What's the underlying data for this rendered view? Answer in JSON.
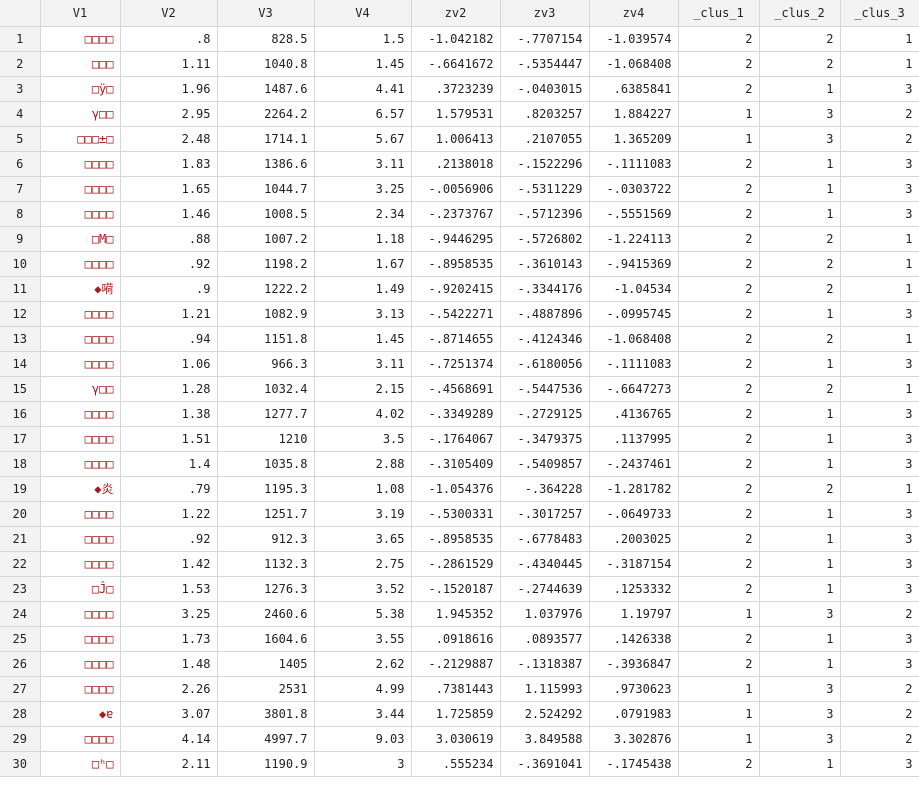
{
  "columns": [
    "",
    "V1",
    "V2",
    "V3",
    "V4",
    "zv2",
    "zv3",
    "zv4",
    "_clus_1",
    "_clus_2",
    "_clus_3"
  ],
  "rows": [
    [
      "1",
      "□□□□",
      ".8",
      "828.5",
      "1.5",
      "-1.042182",
      "-.7707154",
      "-1.039574",
      "2",
      "2",
      "1"
    ],
    [
      "2",
      "□□□",
      "1.11",
      "1040.8",
      "1.45",
      "-.6641672",
      "-.5354447",
      "-1.068408",
      "2",
      "2",
      "1"
    ],
    [
      "3",
      "□ÿ□",
      "1.96",
      "1487.6",
      "4.41",
      ".3723239",
      "-.0403015",
      ".6385841",
      "2",
      "1",
      "3"
    ],
    [
      "4",
      "γ□□",
      "2.95",
      "2264.2",
      "6.57",
      "1.579531",
      ".8203257",
      "1.884227",
      "1",
      "3",
      "2"
    ],
    [
      "5",
      "□□□±□",
      "2.48",
      "1714.1",
      "5.67",
      "1.006413",
      ".2107055",
      "1.365209",
      "1",
      "3",
      "2"
    ],
    [
      "6",
      "□□□□",
      "1.83",
      "1386.6",
      "3.11",
      ".2138018",
      "-.1522296",
      "-.1111083",
      "2",
      "1",
      "3"
    ],
    [
      "7",
      "□□□□",
      "1.65",
      "1044.7",
      "3.25",
      "-.0056906",
      "-.5311229",
      "-.0303722",
      "2",
      "1",
      "3"
    ],
    [
      "8",
      "□□□□",
      "1.46",
      "1008.5",
      "2.34",
      "-.2373767",
      "-.5712396",
      "-.5551569",
      "2",
      "1",
      "3"
    ],
    [
      "9",
      "□M□",
      ".88",
      "1007.2",
      "1.18",
      "-.9446295",
      "-.5726802",
      "-1.224113",
      "2",
      "2",
      "1"
    ],
    [
      "10",
      "□□□□",
      ".92",
      "1198.2",
      "1.67",
      "-.8958535",
      "-.3610143",
      "-.9415369",
      "2",
      "2",
      "1"
    ],
    [
      "11",
      "◆嗬",
      ".9",
      "1222.2",
      "1.49",
      "-.9202415",
      "-.3344176",
      "-1.04534",
      "2",
      "2",
      "1"
    ],
    [
      "12",
      "□□□□",
      "1.21",
      "1082.9",
      "3.13",
      "-.5422271",
      "-.4887896",
      "-.0995745",
      "2",
      "1",
      "3"
    ],
    [
      "13",
      "□□□□",
      ".94",
      "1151.8",
      "1.45",
      "-.8714655",
      "-.4124346",
      "-1.068408",
      "2",
      "2",
      "1"
    ],
    [
      "14",
      "□□□□",
      "1.06",
      "966.3",
      "3.11",
      "-.7251374",
      "-.6180056",
      "-.1111083",
      "2",
      "1",
      "3"
    ],
    [
      "15",
      "γ□□",
      "1.28",
      "1032.4",
      "2.15",
      "-.4568691",
      "-.5447536",
      "-.6647273",
      "2",
      "2",
      "1"
    ],
    [
      "16",
      "□□□□",
      "1.38",
      "1277.7",
      "4.02",
      "-.3349289",
      "-.2729125",
      ".4136765",
      "2",
      "1",
      "3"
    ],
    [
      "17",
      "□□□□",
      "1.51",
      "1210",
      "3.5",
      "-.1764067",
      "-.3479375",
      ".1137995",
      "2",
      "1",
      "3"
    ],
    [
      "18",
      "□□□□",
      "1.4",
      "1035.8",
      "2.88",
      "-.3105409",
      "-.5409857",
      "-.2437461",
      "2",
      "1",
      "3"
    ],
    [
      "19",
      "◆炎",
      ".79",
      "1195.3",
      "1.08",
      "-1.054376",
      "-.364228",
      "-1.281782",
      "2",
      "2",
      "1"
    ],
    [
      "20",
      "□□□□",
      "1.22",
      "1251.7",
      "3.19",
      "-.5300331",
      "-.3017257",
      "-.0649733",
      "2",
      "1",
      "3"
    ],
    [
      "21",
      "□□□□",
      ".92",
      "912.3",
      "3.65",
      "-.8958535",
      "-.6778483",
      ".2003025",
      "2",
      "1",
      "3"
    ],
    [
      "22",
      "□□□□",
      "1.42",
      "1132.3",
      "2.75",
      "-.2861529",
      "-.4340445",
      "-.3187154",
      "2",
      "1",
      "3"
    ],
    [
      "23",
      "□Ĵ□",
      "1.53",
      "1276.3",
      "3.52",
      "-.1520187",
      "-.2744639",
      ".1253332",
      "2",
      "1",
      "3"
    ],
    [
      "24",
      "□□□□",
      "3.25",
      "2460.6",
      "5.38",
      "1.945352",
      "1.037976",
      "1.19797",
      "1",
      "3",
      "2"
    ],
    [
      "25",
      "□□□□",
      "1.73",
      "1604.6",
      "3.55",
      ".0918616",
      ".0893577",
      ".1426338",
      "2",
      "1",
      "3"
    ],
    [
      "26",
      "□□□□",
      "1.48",
      "1405",
      "2.62",
      "-.2129887",
      "-.1318387",
      "-.3936847",
      "2",
      "1",
      "3"
    ],
    [
      "27",
      "□□□□",
      "2.26",
      "2531",
      "4.99",
      ".7381443",
      "1.115993",
      ".9730623",
      "1",
      "3",
      "2"
    ],
    [
      "28",
      "◆ɐ",
      "3.07",
      "3801.8",
      "3.44",
      "1.725859",
      "2.524292",
      ".0791983",
      "1",
      "3",
      "2"
    ],
    [
      "29",
      "□□□□",
      "4.14",
      "4997.7",
      "9.03",
      "3.030619",
      "3.849588",
      "3.302876",
      "1",
      "3",
      "2"
    ],
    [
      "30",
      "□ʰ□",
      "2.11",
      "1190.9",
      "3",
      ".555234",
      "-.3691041",
      "-.1745438",
      "2",
      "1",
      "3"
    ]
  ],
  "colors": {
    "header_bg": "#f3f3f3",
    "grid_line": "#d7d7d7",
    "string_text": "#a61b1b"
  }
}
